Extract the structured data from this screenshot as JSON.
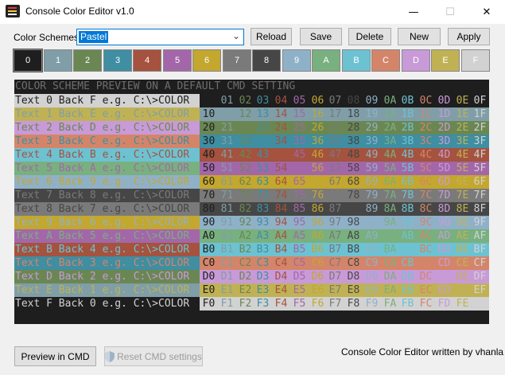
{
  "window": {
    "title": "Console Color Editor v1.0",
    "icon": "console-app-icon",
    "controls": [
      "minimize-icon",
      "maximize-icon",
      "close-icon"
    ]
  },
  "toolbar": {
    "schemes_label": "Color Schemes:",
    "scheme_value": "Pastel",
    "buttons": {
      "reload": "Reload",
      "save": "Save",
      "delete": "Delete",
      "new": "New",
      "apply": "Apply"
    }
  },
  "palette": [
    {
      "label": "0",
      "color": "#1e1e1e",
      "text": "#ffffff"
    },
    {
      "label": "1",
      "color": "#7f9ea8",
      "text": "#ffffff"
    },
    {
      "label": "2",
      "color": "#6a8753",
      "text": "#ffffff"
    },
    {
      "label": "3",
      "color": "#3f8ea2",
      "text": "#ffffff"
    },
    {
      "label": "4",
      "color": "#a5523e",
      "text": "#ffffff"
    },
    {
      "label": "5",
      "color": "#a367a9",
      "text": "#ffffff"
    },
    {
      "label": "6",
      "color": "#c3a72e",
      "text": "#ffffff"
    },
    {
      "label": "7",
      "color": "#7a7a7a",
      "text": "#ffffff"
    },
    {
      "label": "8",
      "color": "#464646",
      "text": "#ffffff"
    },
    {
      "label": "9",
      "color": "#8fb1c8",
      "text": "#ffffff"
    },
    {
      "label": "A",
      "color": "#79b07f",
      "text": "#ffffff"
    },
    {
      "label": "B",
      "color": "#6dc2d2",
      "text": "#ffffff"
    },
    {
      "label": "C",
      "color": "#d48569",
      "text": "#ffffff"
    },
    {
      "label": "D",
      "color": "#c99ad8",
      "text": "#ffffff"
    },
    {
      "label": "E",
      "color": "#c0b254",
      "text": "#ffffff"
    },
    {
      "label": "F",
      "color": "#d2d2d2",
      "text": "#ffffff"
    }
  ],
  "preview": {
    "header": "COLOR SCHEME PREVIEW ON A DEFAULT CMD SETTING",
    "rows": [
      "Text 0 Back F e.g. C:\\>COLOR",
      "Text 1 Back E e.g. C:\\>COLOR",
      "Text 2 Back D e.g. C:\\>COLOR",
      "Text 3 Back C e.g. C:\\>COLOR",
      "Text 4 Back B e.g. C:\\>COLOR",
      "Text 5 Back A e.g. C:\\>COLOR",
      "Text 6 Back 9 e.g. C:\\>COLOR",
      "Text 7 Back 8 e.g. C:\\>COLOR",
      "Text 8 Back 7 e.g. C:\\>COLOR",
      "Text 9 Back 6 e.g. C:\\>COLOR",
      "Text A Back 5 e.g. C:\\>COLOR",
      "Text B Back 4 e.g. C:\\>COLOR",
      "Text C Back 3 e.g. C:\\>COLOR",
      "Text D Back 2 e.g. C:\\>COLOR",
      "Text E Back 1 e.g. C:\\>COLOR",
      "Text F Back 0 e.g. C:\\>COLOR"
    ],
    "hex_digits": [
      "0",
      "1",
      "2",
      "3",
      "4",
      "5",
      "6",
      "7",
      "8",
      "9",
      "A",
      "B",
      "C",
      "D",
      "E",
      "F"
    ]
  },
  "footer": {
    "preview_button": "Preview in CMD",
    "reset_button": "Reset CMD settings",
    "credit": "Console Color Editor written by vhanla"
  }
}
